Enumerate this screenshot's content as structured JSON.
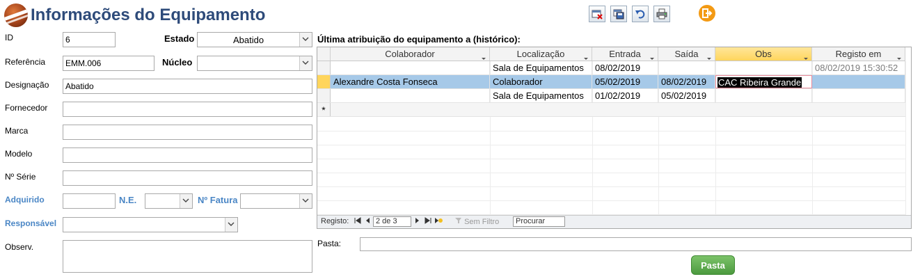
{
  "header": {
    "title": "Informações do Equipamento"
  },
  "colors": {
    "accent": "#2e4b7a",
    "label_blue": "#4a86c5",
    "selected_row": "#a6c9e8",
    "active_header": "#ffd55c",
    "pasta_button": "#5cab4d",
    "exit": "#f39a14"
  },
  "toolbar": {
    "icons": [
      "delete-record-icon",
      "save-record-icon",
      "undo-icon",
      "print-icon",
      "exit-icon"
    ]
  },
  "form": {
    "id": {
      "label": "ID",
      "value": "6"
    },
    "estado": {
      "label": "Estado",
      "value": "Abatido"
    },
    "referencia": {
      "label": "Referência",
      "value": "EMM.006"
    },
    "nucleo": {
      "label": "Núcleo",
      "value": ""
    },
    "designacao": {
      "label": "Designação",
      "value": "Abatido"
    },
    "fornecedor": {
      "label": "Fornecedor",
      "value": ""
    },
    "marca": {
      "label": "Marca",
      "value": ""
    },
    "modelo": {
      "label": "Modelo",
      "value": ""
    },
    "serie": {
      "label": "Nº Série",
      "value": ""
    },
    "adquirido": {
      "label": "Adquirido",
      "value": ""
    },
    "ne": {
      "label": "N.E.",
      "value": ""
    },
    "fatura": {
      "label": "Nº Fatura",
      "value": ""
    },
    "responsavel": {
      "label": "Responsável",
      "value": ""
    },
    "observ": {
      "label": "Observ.",
      "value": ""
    }
  },
  "history": {
    "title": "Última atribuição do equipamento a (histórico):",
    "columns": [
      "Colaborador",
      "Localização",
      "Entrada",
      "Saída",
      "Obs",
      "Registo em"
    ],
    "rows": [
      [
        "",
        "Sala de Equipamentos",
        "08/02/2019",
        "",
        "",
        "08/02/2019 15:30:52"
      ],
      [
        "Alexandre Costa Fonseca",
        "Colaborador",
        "05/02/2019",
        "08/02/2019",
        "CAC Ribeira Grande",
        ""
      ],
      [
        "",
        "Sala de Equipamentos",
        "01/02/2019",
        "05/02/2019",
        "",
        ""
      ]
    ],
    "new_row_marker": "*",
    "nav": {
      "label": "Registo:",
      "position": "2 de 3",
      "filter": "Sem Filtro",
      "search": "Procurar"
    }
  },
  "pasta": {
    "label": "Pasta:",
    "value": "",
    "button": "Pasta"
  }
}
